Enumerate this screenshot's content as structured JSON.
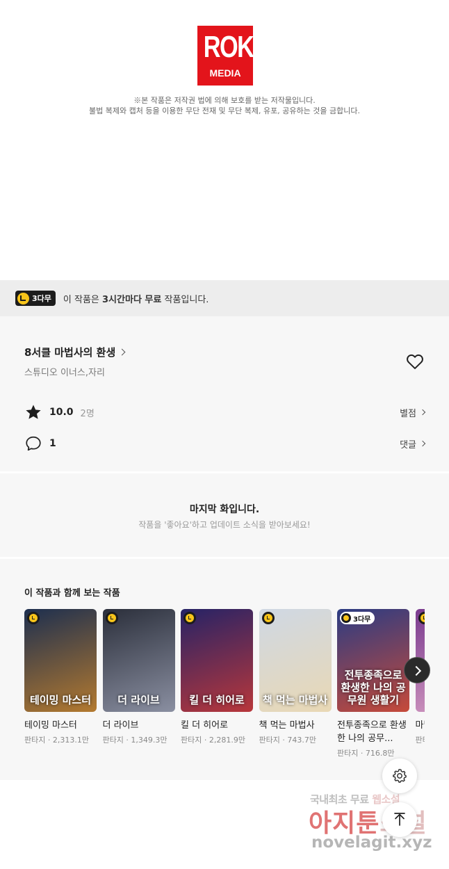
{
  "publisher": {
    "logo_top": "ROK",
    "logo_bottom": "MEDIA",
    "notice_line1": "※본 작품은 저작권 법에 의해 보호를 받는 저작물입니다.",
    "notice_line2": "불법 복제와 캡처 등을 이용한 무단 전재 및 무단 복제, 유포, 공유하는 것을 금합니다."
  },
  "free_banner": {
    "badge": "3다무",
    "text_prefix": "이 작품은 ",
    "text_bold": "3시간마다 무료",
    "text_suffix": " 작품입니다."
  },
  "work": {
    "title": "8서클 마법사의 환생",
    "author": "스튜디오 이너스,자리",
    "rating": "10.0",
    "rating_count": "2명",
    "rating_link": "별점",
    "comment_count": "1",
    "comment_link": "댓글"
  },
  "last_episode": {
    "title": "마지막 화입니다.",
    "subtitle": "작품을 '좋아요'하고 업데이트 소식을 받아보세요!"
  },
  "recommendations": {
    "title": "이 작품과 함께 보는 작품",
    "items": [
      {
        "name": "테이밍 마스터",
        "meta": "판타지 · 2,313.1만",
        "cover_text": "테이밍 마스터",
        "badge": "",
        "colors": [
          "#1d2f4f",
          "#b47a2f"
        ]
      },
      {
        "name": "더 라이브",
        "meta": "판타지 · 1,349.3만",
        "cover_text": "더 라이브",
        "badge": "",
        "colors": [
          "#2b2f3b",
          "#8a8fa1"
        ]
      },
      {
        "name": "킬 더 히어로",
        "meta": "판타지 · 2,281.9만",
        "cover_text": "킬 더 히어로",
        "badge": "",
        "colors": [
          "#262366",
          "#b8373b"
        ]
      },
      {
        "name": "책 먹는 마법사",
        "meta": "판타지 · 743.7만",
        "cover_text": "책 먹는 마법사",
        "badge": "",
        "colors": [
          "#cfd8e4",
          "#e9d8b4"
        ]
      },
      {
        "name": "전투종족으로 환생한 나의 공무...",
        "meta": "판타지 · 716.8만",
        "cover_text": "전투종족으로 환생한 나의 공무원 생활기",
        "badge": "3다무",
        "colors": [
          "#2b3c83",
          "#c64a3a"
        ]
      },
      {
        "name": "마법",
        "meta": "판타지",
        "cover_text": "",
        "badge": "",
        "colors": [
          "#7a3b8f",
          "#d9a0c4"
        ]
      }
    ]
  },
  "watermark": {
    "line1_a": "국내최초 무료 ",
    "line1_b": "웹소설",
    "line2_a": "아지툰",
    "line2_b": "소설",
    "line3": "novelagit.xyz"
  },
  "icons": {
    "heart": "heart-icon",
    "star": "star-icon",
    "comment": "comment-icon",
    "settings": "gear-icon",
    "scroll_top": "arrow-up-icon",
    "next": "chevron-right-icon"
  },
  "colors": {
    "brand_red": "#e3141b",
    "badge_yellow": "#f7c41a"
  }
}
